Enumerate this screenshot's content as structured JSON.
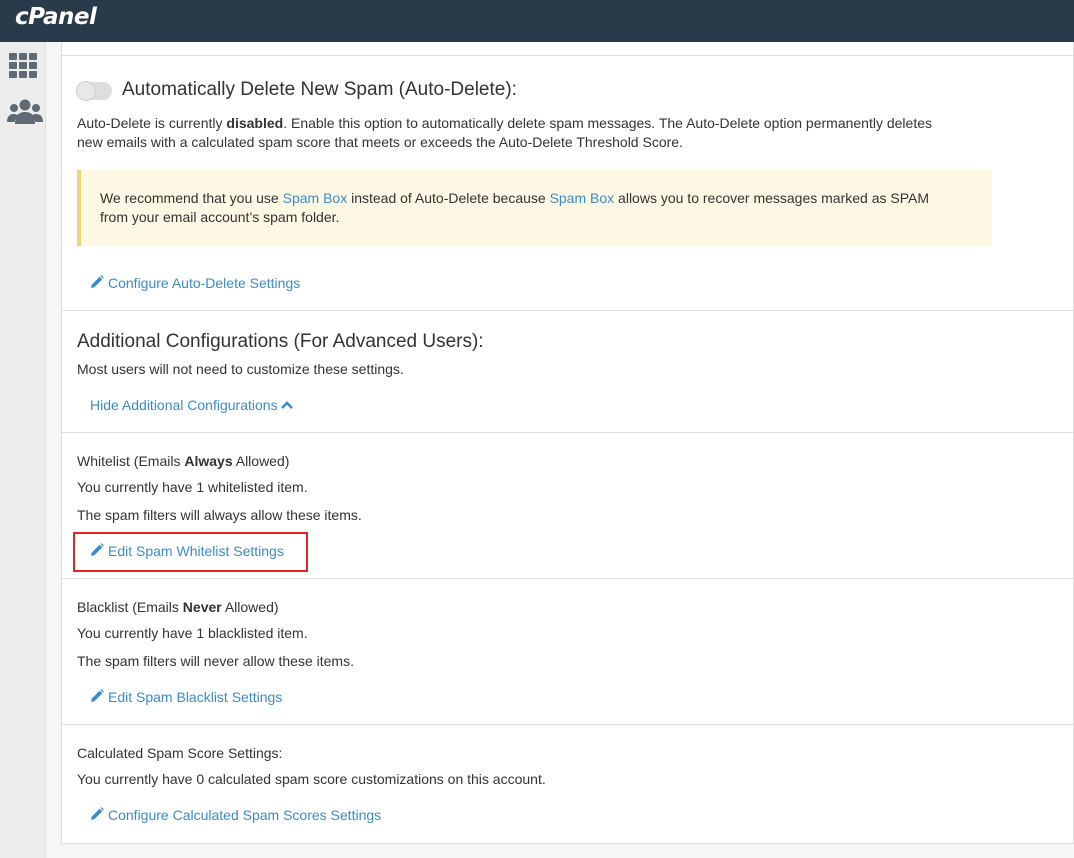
{
  "header": {
    "logo": "cPanel"
  },
  "sidebar": {
    "icons": [
      "grid-icon",
      "users-icon"
    ]
  },
  "autodelete": {
    "title": "Automatically Delete New Spam (Auto-Delete):",
    "toggle_state": "off",
    "desc_prefix": "Auto-Delete is currently ",
    "desc_status": "disabled",
    "desc_suffix": ". Enable this option to automatically delete spam messages. The Auto-Delete option permanently deletes",
    "desc_line2": "new emails with a calculated spam score that meets or exceeds the Auto-Delete Threshold Score.",
    "alert_prefix": "We recommend that you use ",
    "alert_link1": "Spam Box",
    "alert_mid": " instead of Auto-Delete because ",
    "alert_link2": "Spam Box",
    "alert_suffix": " allows you to recover messages marked as SPAM",
    "alert_line2": "from your email account’s spam folder.",
    "configure_link": "Configure Auto-Delete Settings"
  },
  "additional": {
    "title": "Additional Configurations (For Advanced Users):",
    "desc": "Most users will not need to customize these settings.",
    "hide_link": "Hide Additional Configurations"
  },
  "whitelist": {
    "title_prefix": "Whitelist (Emails ",
    "title_bold": "Always",
    "title_suffix": " Allowed)",
    "count_text": "You currently have 1 whitelisted item.",
    "desc": "The spam filters will always allow these items.",
    "edit_link": "Edit Spam Whitelist Settings"
  },
  "blacklist": {
    "title_prefix": "Blacklist (Emails ",
    "title_bold": "Never",
    "title_suffix": " Allowed)",
    "count_text": "You currently have 1 blacklisted item.",
    "desc": "The spam filters will never allow these items.",
    "edit_link": "Edit Spam Blacklist Settings"
  },
  "calculated": {
    "title": "Calculated Spam Score Settings:",
    "desc": "You currently have 0 calculated spam score customizations on this account.",
    "configure_link": "Configure Calculated Spam Scores Settings"
  },
  "colors": {
    "link": "#3b8bca",
    "highlight": "#e12424",
    "topbar": "#293a4a",
    "alert_bg": "#fdf8e4"
  }
}
